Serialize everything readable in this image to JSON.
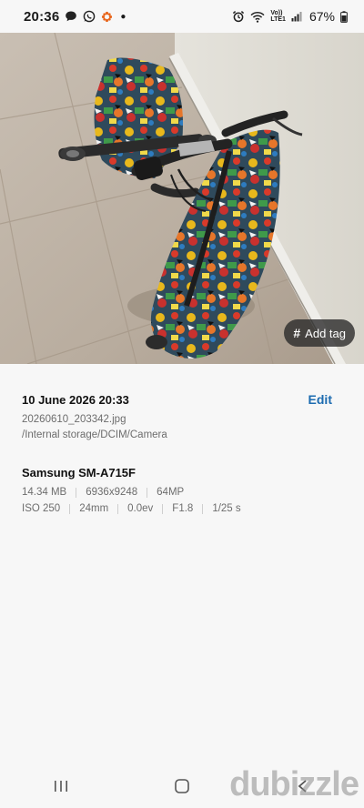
{
  "status_bar": {
    "time": "20:36",
    "network": "Vo))\nLTE1",
    "battery_pct": "67%",
    "icons": [
      "chat-bubble-icon",
      "whatsapp-icon",
      "flower-icon",
      "dot-icon",
      "alarm-icon",
      "wifi-icon",
      "signal-icon",
      "battery-icon"
    ]
  },
  "photo": {
    "add_tag_label": "Add tag"
  },
  "details": {
    "date": "10 June 2026 20:33",
    "edit_label": "Edit",
    "filename": "20260610_203342.jpg",
    "path": "/Internal storage/DCIM/Camera",
    "device": "Samsung SM-A715F",
    "specs_row1": [
      "14.34 MB",
      "6936x9248",
      "64MP"
    ],
    "specs_row2": [
      "ISO 250",
      "24mm",
      "0.0ev",
      "F1.8",
      "1/25 s"
    ]
  },
  "watermark": "dubizzle",
  "colors": {
    "accent": "#1c6bb0",
    "background": "#f7f7f7"
  }
}
